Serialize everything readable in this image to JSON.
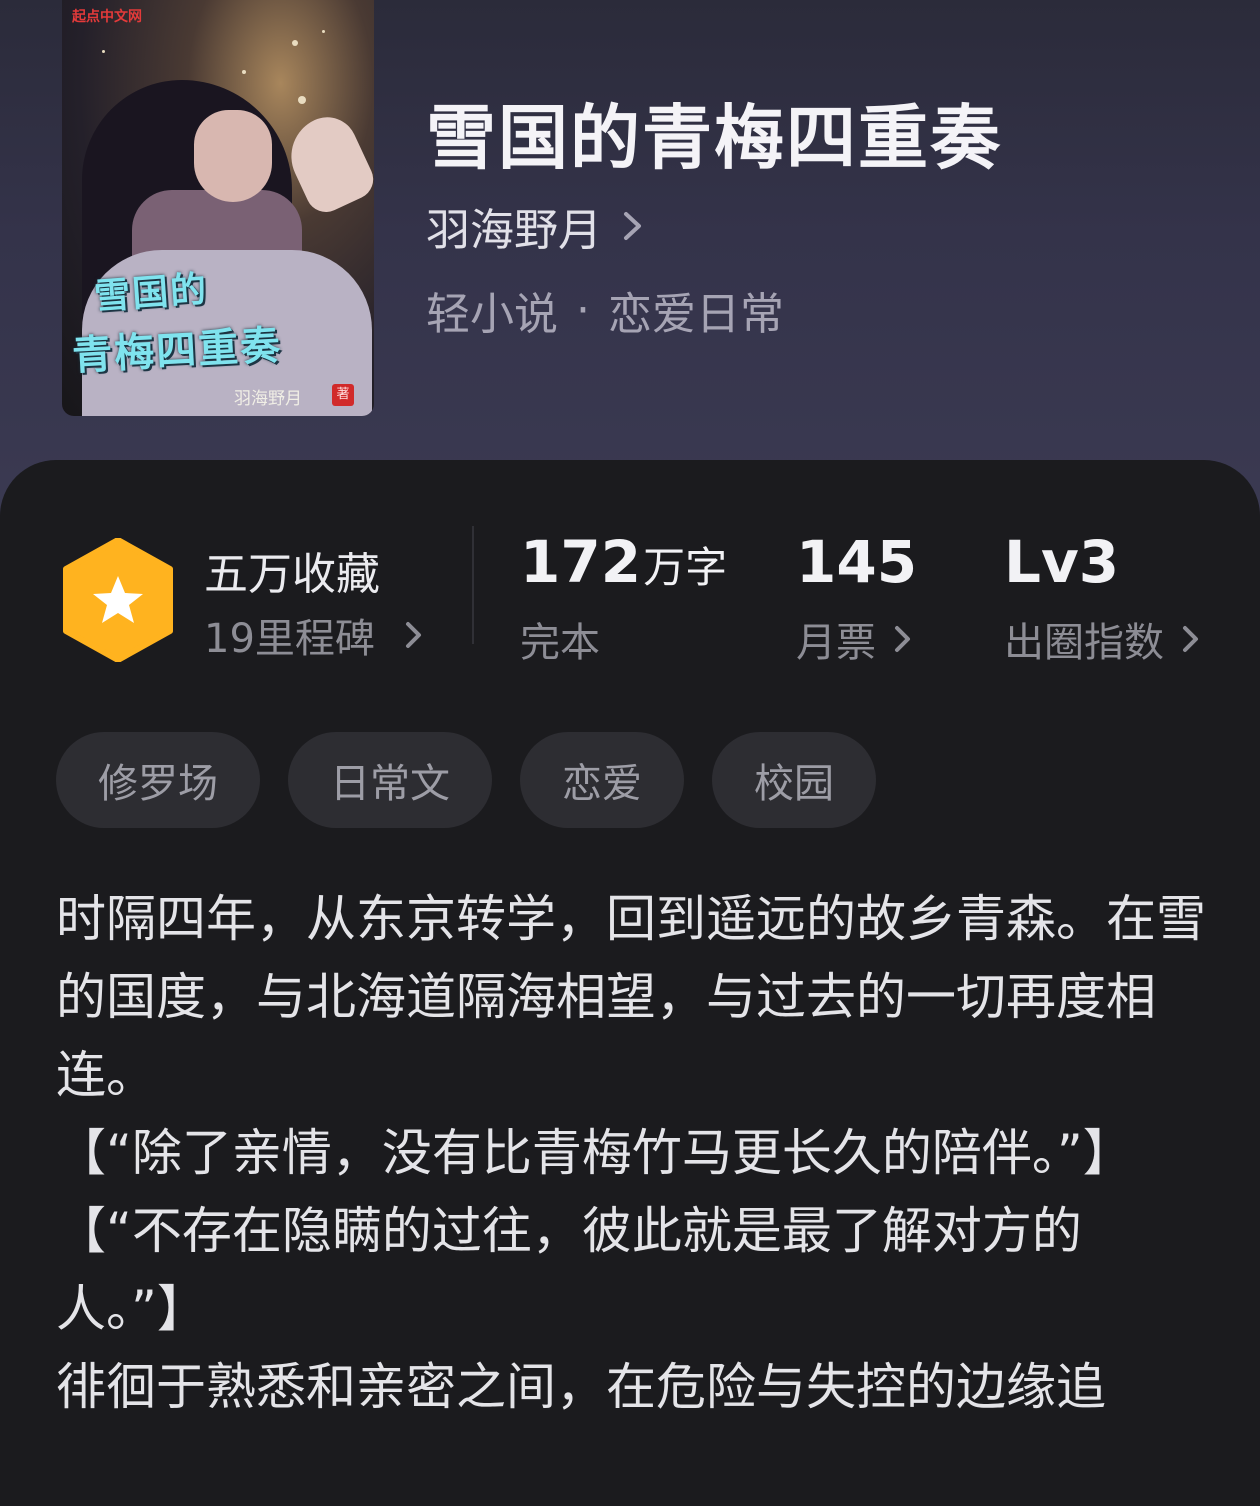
{
  "book": {
    "title": "雪国的青梅四重奏",
    "author": "羽海野月",
    "category": "轻小说",
    "genre_separator": "·",
    "subcategory": "恋爱日常"
  },
  "cover": {
    "brand": "起点中文网",
    "title_line1": "雪国的",
    "title_line2": "青梅四重奏",
    "author": "羽海野月",
    "seal": "著"
  },
  "stats": {
    "favorites_title": "五万收藏",
    "milestones": "19里程碑",
    "word_count_value": "172",
    "word_count_unit": "万字",
    "status": "完本",
    "monthly_votes_value": "145",
    "monthly_votes_label": "月票",
    "level_value": "Lv3",
    "level_label": "出圈指数"
  },
  "tags": [
    "修罗场",
    "日常文",
    "恋爱",
    "校园"
  ],
  "description": [
    "时隔四年，从东京转学，回到遥远的故乡青森。在雪的国度，与北海道隔海相望，与过去的一切再度相连。",
    "【“除了亲情，没有比青梅竹马更长久的陪伴。”】",
    "【“不存在隐瞒的过往，彼此就是最了解对方的人。”】",
    "徘徊于熟悉和亲密之间，在危险与失控的边缘追"
  ],
  "colors": {
    "header_bg": "#34334a",
    "panel_bg": "#1b1b1e",
    "badge_orange": "#ffb31f",
    "tag_bg": "#2d2d32"
  }
}
